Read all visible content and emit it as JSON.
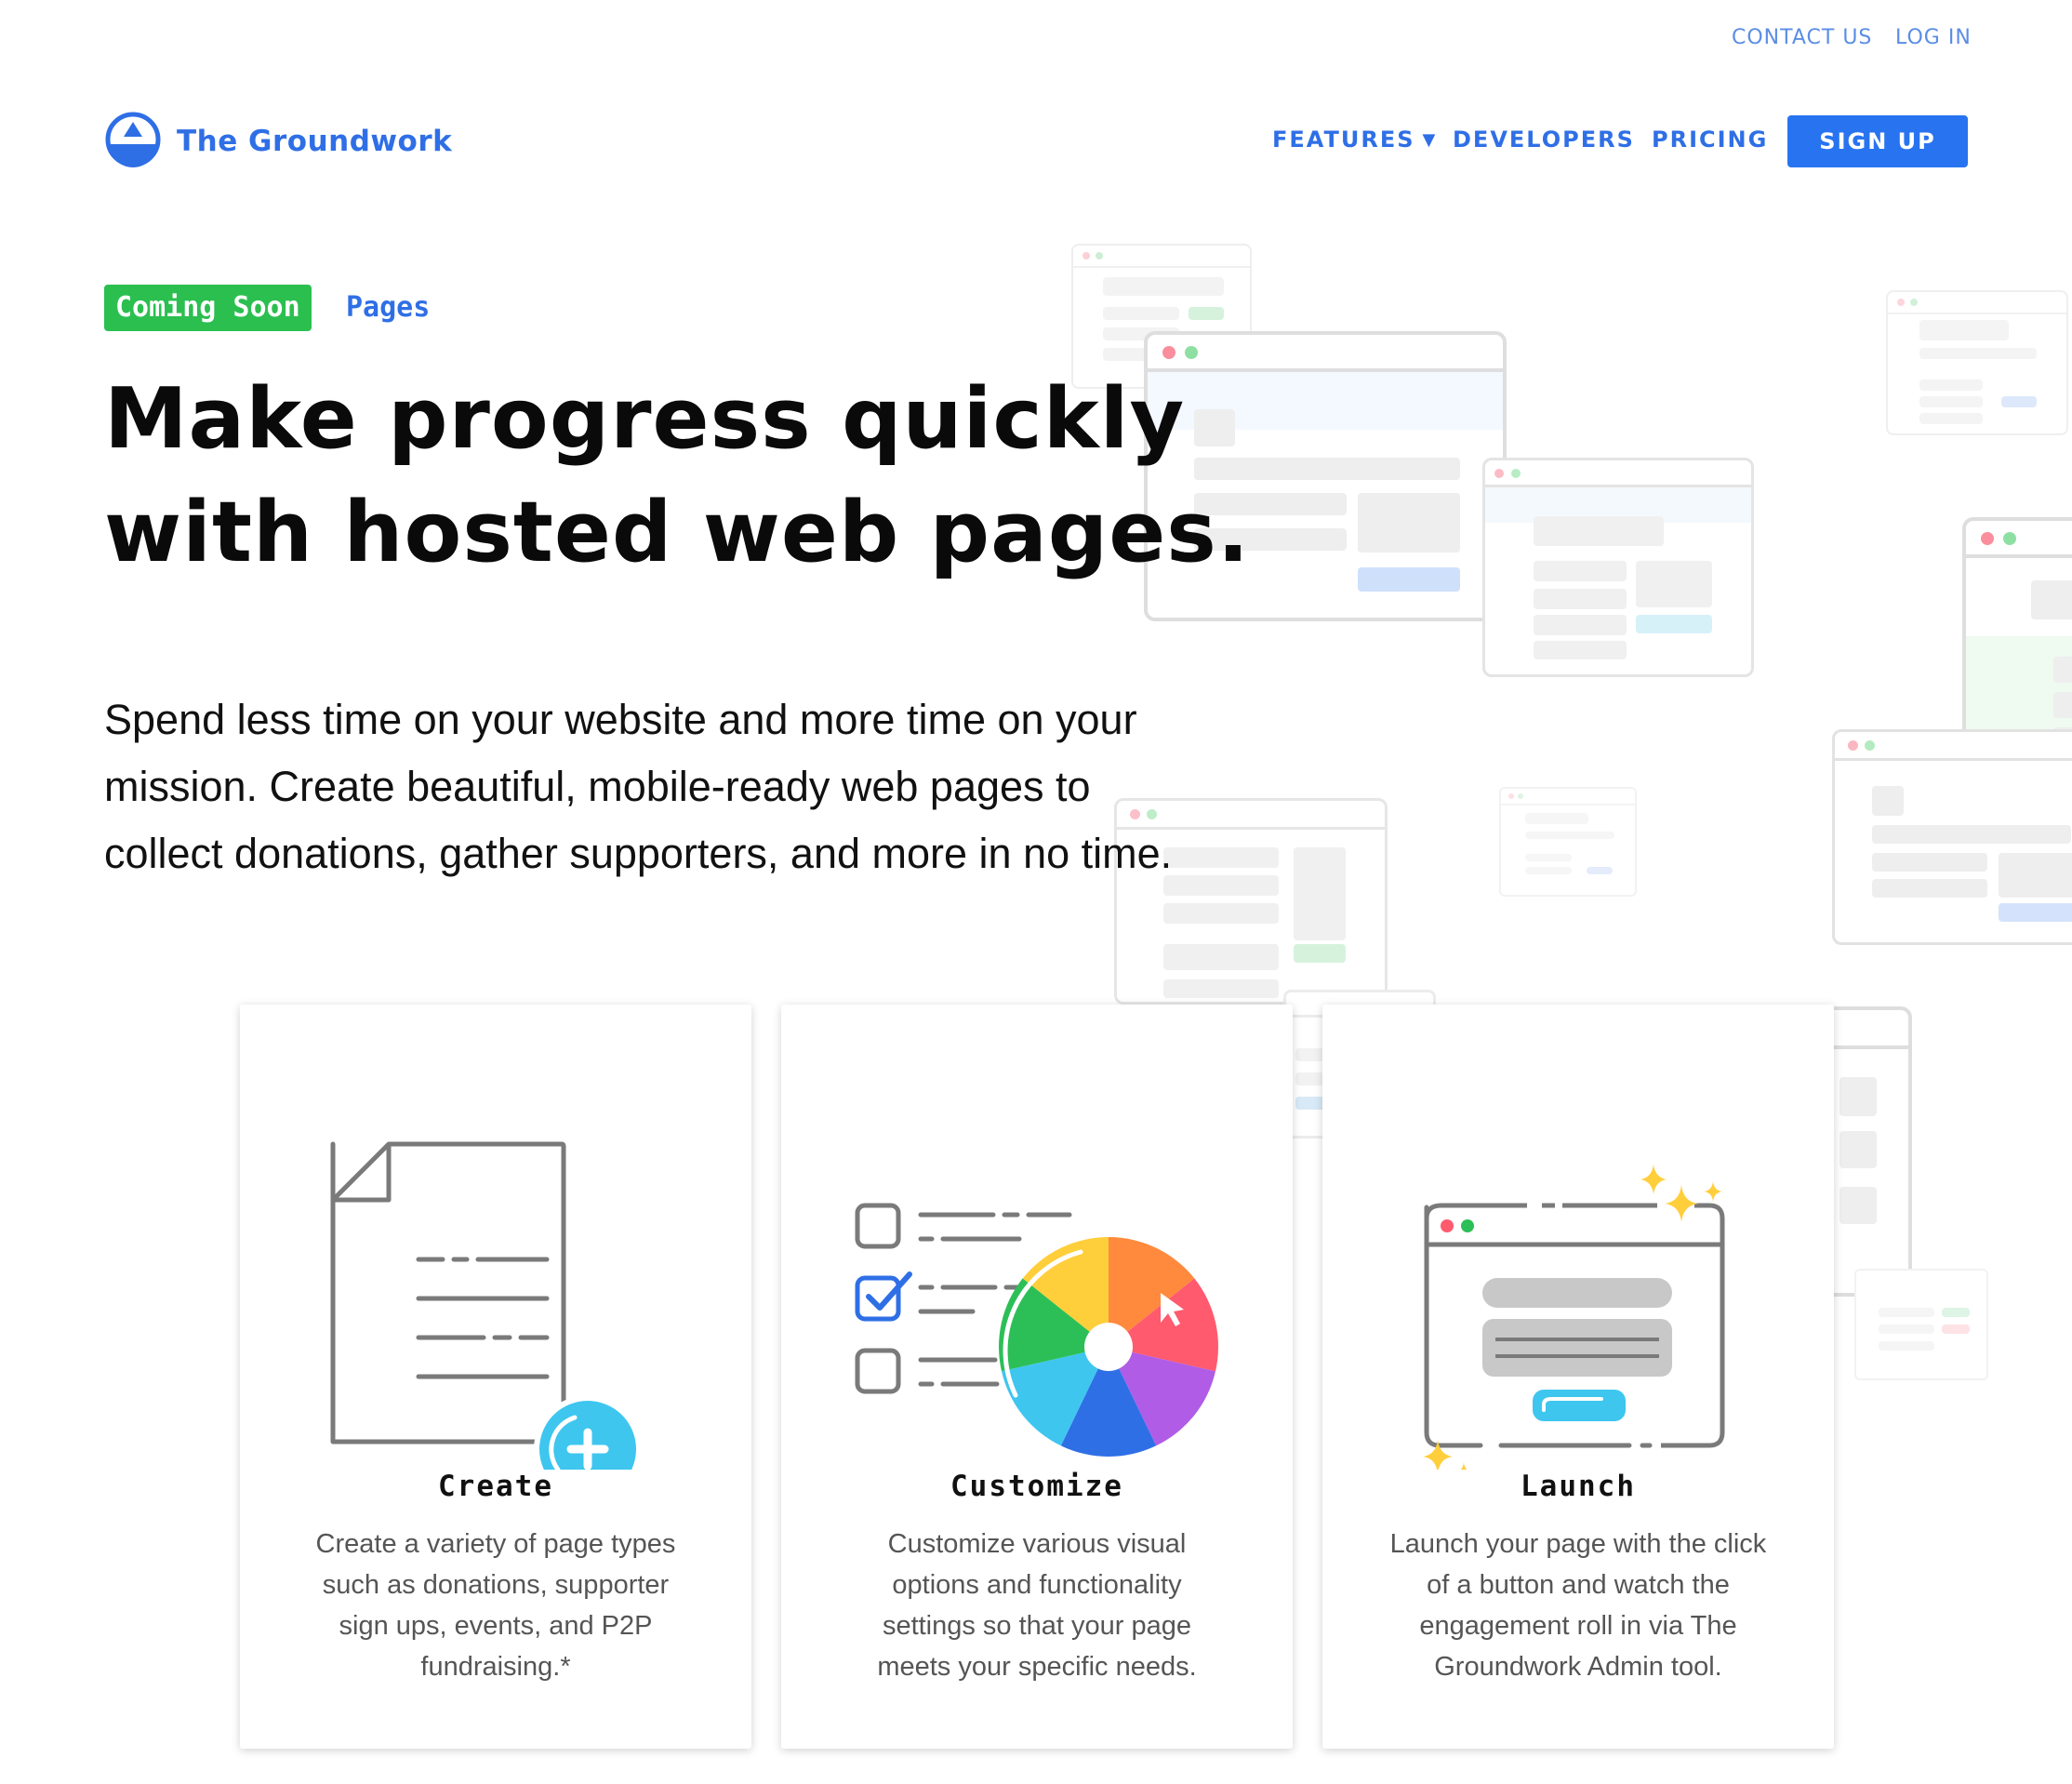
{
  "top_links": {
    "contact": "CONTACT US",
    "login": "LOG IN"
  },
  "brand": {
    "name": "The Groundwork",
    "icon": "triangle-circle-logo"
  },
  "nav": {
    "features": "FEATURES",
    "features_caret": "▼",
    "developers": "DEVELOPERS",
    "pricing": "PRICING",
    "signup": "SIGN UP"
  },
  "hero": {
    "badge": "Coming Soon",
    "badge_label": "Pages",
    "headline_lines": [
      "Make progress quickly",
      "with hosted web pages."
    ],
    "lead_lines": [
      "Spend less time on your website and more time on your",
      "mission. Create beautiful, mobile-ready web pages to",
      "collect donations, gather supporters, and more in no time."
    ]
  },
  "cards": [
    {
      "title": "Create",
      "icon": "new-document-icon",
      "desc_lines": [
        "Create a variety of page types",
        "such as donations, supporter",
        "sign ups, events, and P2P",
        "fundraising.*"
      ]
    },
    {
      "title": "Customize",
      "icon": "color-wheel-checklist-icon",
      "desc_lines": [
        "Customize various visual",
        "options and functionality",
        "settings so that your page",
        "meets your specific needs."
      ]
    },
    {
      "title": "Launch",
      "icon": "browser-launch-sparkle-icon",
      "desc_lines": [
        "Launch your page with the click",
        "of a button and watch the",
        "engagement roll in via The",
        "Groundwork Admin tool."
      ]
    }
  ],
  "colors": {
    "brand_blue": "#2f6fe6",
    "signup_bg": "#2874f0",
    "badge_green": "#2bbf4f",
    "link_light_blue": "#5b8de6"
  }
}
